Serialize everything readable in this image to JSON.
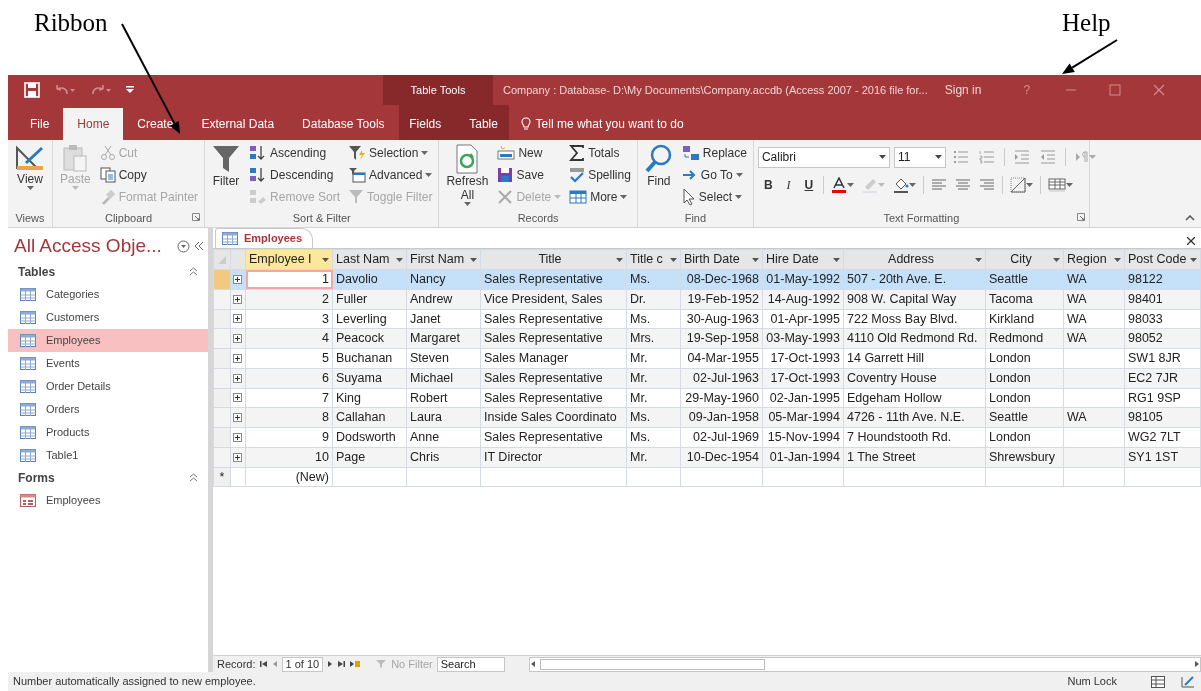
{
  "annotations": [
    {
      "text": "Ribbon"
    },
    {
      "text": "Help"
    }
  ],
  "title_bar": {
    "contextual_label": "Table Tools",
    "title": "Company : Database- D:\\My Documents\\Company.accdb (Access 2007 - 2016 file for...",
    "sign_in": "Sign in",
    "help": "?"
  },
  "ribbon_tabs": [
    {
      "label": "File",
      "selected": false,
      "contextual": false
    },
    {
      "label": "Home",
      "selected": true,
      "contextual": false
    },
    {
      "label": "Create",
      "selected": false,
      "contextual": false
    },
    {
      "label": "External Data",
      "selected": false,
      "contextual": false
    },
    {
      "label": "Database Tools",
      "selected": false,
      "contextual": false
    },
    {
      "label": "Fields",
      "selected": false,
      "contextual": true
    },
    {
      "label": "Table",
      "selected": false,
      "contextual": true
    }
  ],
  "tell_me": "Tell me what you want to do",
  "ribbon_groups": [
    {
      "kind": "buttons",
      "name": "Views",
      "launcher": false,
      "items": [
        {
          "kind": "large",
          "label": "View",
          "dropdown": true,
          "disabled": false
        }
      ]
    },
    {
      "kind": "buttons",
      "name": "Clipboard",
      "launcher": true,
      "items": [
        {
          "kind": "large",
          "label": "Paste",
          "dropdown": true,
          "disabled": true
        },
        {
          "kind": "small",
          "label": "Cut",
          "dropdown": false,
          "disabled": true
        },
        {
          "kind": "small",
          "label": "Copy",
          "dropdown": false,
          "disabled": false
        },
        {
          "kind": "small",
          "label": "Format Painter",
          "dropdown": false,
          "disabled": true
        }
      ]
    },
    {
      "kind": "buttons",
      "name": "Sort & Filter",
      "launcher": false,
      "items": [
        {
          "kind": "large",
          "label": "Filter",
          "dropdown": false,
          "disabled": false
        },
        {
          "kind": "small",
          "label": "Ascending",
          "dropdown": false,
          "disabled": false
        },
        {
          "kind": "small",
          "label": "Descending",
          "dropdown": false,
          "disabled": false
        },
        {
          "kind": "small",
          "label": "Remove Sort",
          "dropdown": false,
          "disabled": true
        },
        {
          "kind": "small",
          "label": "Selection",
          "dropdown": true,
          "disabled": false
        },
        {
          "kind": "small",
          "label": "Advanced",
          "dropdown": true,
          "disabled": false
        },
        {
          "kind": "small",
          "label": "Toggle Filter",
          "dropdown": false,
          "disabled": true
        }
      ]
    },
    {
      "kind": "buttons",
      "name": "Records",
      "launcher": false,
      "items": [
        {
          "kind": "large",
          "label": "Refresh All",
          "dropdown": true,
          "disabled": false
        },
        {
          "kind": "small",
          "label": "New",
          "dropdown": false,
          "disabled": false
        },
        {
          "kind": "small",
          "label": "Save",
          "dropdown": false,
          "disabled": false
        },
        {
          "kind": "small",
          "label": "Delete",
          "dropdown": true,
          "disabled": true
        },
        {
          "kind": "small",
          "label": "Totals",
          "dropdown": false,
          "disabled": false
        },
        {
          "kind": "small",
          "label": "Spelling",
          "dropdown": false,
          "disabled": false
        },
        {
          "kind": "small",
          "label": "More",
          "dropdown": true,
          "disabled": false
        }
      ]
    },
    {
      "kind": "buttons",
      "name": "Find",
      "launcher": false,
      "items": [
        {
          "kind": "large",
          "label": "Find",
          "dropdown": false,
          "disabled": false
        },
        {
          "kind": "small",
          "label": "Replace",
          "dropdown": false,
          "disabled": false
        },
        {
          "kind": "small",
          "label": "Go To",
          "dropdown": true,
          "disabled": false
        },
        {
          "kind": "small",
          "label": "Select",
          "dropdown": true,
          "disabled": false
        }
      ]
    },
    {
      "kind": "text_formatting",
      "name": "Text Formatting",
      "launcher": true,
      "font": "Calibri",
      "size": "11",
      "format_buttons": [
        "B",
        "I",
        "U"
      ]
    }
  ],
  "nav_pane": {
    "title": "All Access Obje...",
    "sections": [
      {
        "name": "Tables",
        "kind": "table",
        "items": [
          {
            "label": "Categories",
            "selected": false
          },
          {
            "label": "Customers",
            "selected": false
          },
          {
            "label": "Employees",
            "selected": true
          },
          {
            "label": "Events",
            "selected": false
          },
          {
            "label": "Order Details",
            "selected": false
          },
          {
            "label": "Orders",
            "selected": false
          },
          {
            "label": "Products",
            "selected": false
          },
          {
            "label": "Table1",
            "selected": false
          }
        ]
      },
      {
        "name": "Forms",
        "kind": "form",
        "items": [
          {
            "label": "Employees",
            "selected": false
          }
        ]
      }
    ]
  },
  "document_tabs": [
    {
      "label": "Employees",
      "selected": true
    }
  ],
  "datasheet": {
    "columns": [
      {
        "label": "Employee I",
        "active": true
      },
      {
        "label": "Last Nam",
        "active": false
      },
      {
        "label": "First Nam",
        "active": false
      },
      {
        "label": "Title",
        "active": false
      },
      {
        "label": "Title c",
        "active": false
      },
      {
        "label": "Birth Date",
        "active": false
      },
      {
        "label": "Hire Date",
        "active": false
      },
      {
        "label": "Address",
        "active": false
      },
      {
        "label": "City",
        "active": false
      },
      {
        "label": "Region",
        "active": false
      },
      {
        "label": "Post Code",
        "active": false
      }
    ],
    "rows": [
      {
        "selected": true,
        "cells": [
          "1",
          "Davolio",
          "Nancy",
          "Sales Representative",
          "Ms.",
          "08-Dec-1968",
          "01-May-1992",
          "507 - 20th Ave. E.",
          "Seattle",
          "WA",
          "98122"
        ]
      },
      {
        "selected": false,
        "cells": [
          "2",
          "Fuller",
          "Andrew",
          "Vice President, Sales",
          "Dr.",
          "19-Feb-1952",
          "14-Aug-1992",
          "908 W. Capital Way",
          "Tacoma",
          "WA",
          "98401"
        ]
      },
      {
        "selected": false,
        "cells": [
          "3",
          "Leverling",
          "Janet",
          "Sales Representative",
          "Ms.",
          "30-Aug-1963",
          "01-Apr-1995",
          "722 Moss Bay Blvd.",
          "Kirkland",
          "WA",
          "98033"
        ]
      },
      {
        "selected": false,
        "cells": [
          "4",
          "Peacock",
          "Margaret",
          "Sales Representative",
          "Mrs.",
          "19-Sep-1958",
          "03-May-1993",
          "4110 Old Redmond Rd.",
          "Redmond",
          "WA",
          "98052"
        ]
      },
      {
        "selected": false,
        "cells": [
          "5",
          "Buchanan",
          "Steven",
          "Sales Manager",
          "Mr.",
          "04-Mar-1955",
          "17-Oct-1993",
          "14 Garrett Hill",
          "London",
          null,
          "SW1 8JR"
        ]
      },
      {
        "selected": false,
        "cells": [
          "6",
          "Suyama",
          "Michael",
          "Sales Representative",
          "Mr.",
          "02-Jul-1963",
          "17-Oct-1993",
          "Coventry House",
          "London",
          null,
          "EC2 7JR"
        ]
      },
      {
        "selected": false,
        "cells": [
          "7",
          "King",
          "Robert",
          "Sales Representative",
          "Mr.",
          "29-May-1960",
          "02-Jan-1995",
          "Edgeham Hollow",
          "London",
          null,
          "RG1 9SP"
        ]
      },
      {
        "selected": false,
        "cells": [
          "8",
          "Callahan",
          "Laura",
          "Inside Sales Coordinato",
          "Ms.",
          "09-Jan-1958",
          "05-Mar-1994",
          "4726 - 11th Ave. N.E.",
          "Seattle",
          "WA",
          "98105"
        ]
      },
      {
        "selected": false,
        "cells": [
          "9",
          "Dodsworth",
          "Anne",
          "Sales Representative",
          "Ms.",
          "02-Jul-1969",
          "15-Nov-1994",
          "7 Houndstooth Rd.",
          "London",
          null,
          "WG2 7LT"
        ]
      },
      {
        "selected": false,
        "cells": [
          "10",
          "Page",
          "Chris",
          "IT Director",
          "Mr.",
          "10-Dec-1954",
          "01-Jan-1994",
          "1 The Street",
          "Shrewsbury",
          null,
          "SY1 1ST"
        ]
      }
    ],
    "new_row": {
      "marker": "*",
      "label": "(New)"
    }
  },
  "record_nav": {
    "label": "Record:",
    "position": "1 of 10",
    "filter": "No Filter",
    "filter_active": false,
    "search_placeholder": "Search"
  },
  "status_bar": {
    "message": "Number automatically assigned to new employee.",
    "indicators": [
      "Num Lock"
    ]
  }
}
